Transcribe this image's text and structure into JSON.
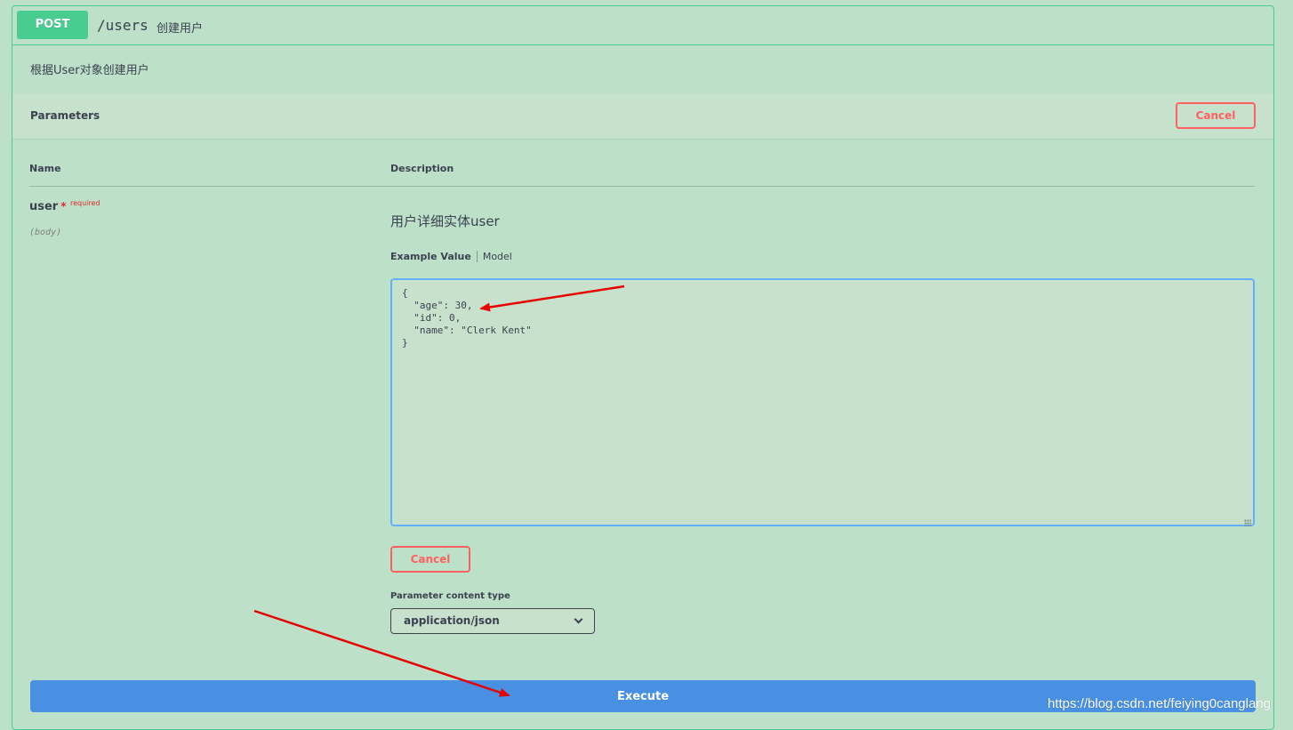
{
  "operation": {
    "method": "POST",
    "path": "/users",
    "summary": "创建用户",
    "description": "根据User对象创建用户"
  },
  "parameters_section": {
    "title": "Parameters",
    "cancel_label": "Cancel"
  },
  "table": {
    "name_header": "Name",
    "description_header": "Description"
  },
  "parameter": {
    "name": "user",
    "required_star": "*",
    "required_label": "required",
    "in": "(body)",
    "description": "用户详细实体user",
    "tabs": [
      "Example Value",
      "Model"
    ],
    "body_value": "{\n  \"age\": 30,\n  \"id\": 0,\n  \"name\": \"Clerk Kent\"\n}",
    "cancel_label": "Cancel"
  },
  "content_type": {
    "label": "Parameter content type",
    "selected": "application/json"
  },
  "execute_label": "Execute",
  "watermark": "https://blog.csdn.net/feiying0canglang",
  "colors": {
    "post_green": "#49cc90",
    "cancel_red": "#ff6060",
    "execute_blue": "#4990e2",
    "textarea_border": "#61affe",
    "annotation_arrow": "#e60000"
  }
}
